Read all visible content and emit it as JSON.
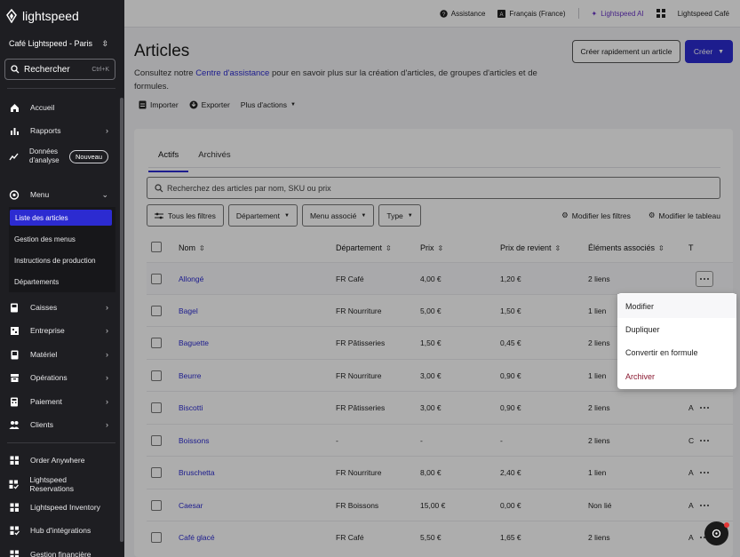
{
  "brand": {
    "name": "lightspeed"
  },
  "sidebar": {
    "store": "Café Lightspeed - Paris",
    "search": {
      "label": "Rechercher",
      "shortcut": "Ctrl+K"
    },
    "items": [
      {
        "label": "Accueil",
        "icon": "home-icon"
      },
      {
        "label": "Rapports",
        "icon": "chart-icon"
      },
      {
        "label": "Données d'analyse",
        "icon": "analytics-icon",
        "badge": "Nouveau"
      },
      {
        "label": "Menu",
        "icon": "menu-icon"
      },
      {
        "label": "Caisses",
        "icon": "register-icon"
      },
      {
        "label": "Entreprise",
        "icon": "business-icon"
      },
      {
        "label": "Matériel",
        "icon": "hardware-icon"
      },
      {
        "label": "Opérations",
        "icon": "operations-icon"
      },
      {
        "label": "Paiement",
        "icon": "payment-icon"
      },
      {
        "label": "Clients",
        "icon": "clients-icon"
      },
      {
        "label": "Order Anywhere",
        "icon": "apps-icon"
      },
      {
        "label": "Lightspeed Reservations",
        "icon": "apps-icon"
      },
      {
        "label": "Lightspeed Inventory",
        "icon": "apps-icon"
      },
      {
        "label": "Hub d'intégrations",
        "icon": "apps-icon"
      },
      {
        "label": "Gestion financière",
        "icon": "apps-icon"
      }
    ],
    "submenu": [
      {
        "label": "Liste des articles",
        "active": true
      },
      {
        "label": "Gestion des menus"
      },
      {
        "label": "Instructions de production"
      },
      {
        "label": "Départements"
      }
    ]
  },
  "topbar": {
    "assistance": "Assistance",
    "language": "Français (France)",
    "ai": "Lightspeed AI",
    "account": "Lightspeed Café"
  },
  "page": {
    "title": "Articles",
    "desc_prefix": "Consultez notre ",
    "desc_link": "Centre d'assistance",
    "desc_suffix": " pour en savoir plus sur la création d'articles, de groupes d'articles et de formules.",
    "quick_create": "Créer rapidement un article",
    "create": "Créer",
    "actions": {
      "import": "Importer",
      "export": "Exporter",
      "more": "Plus d'actions"
    }
  },
  "card": {
    "tabs": [
      "Actifs",
      "Archivés"
    ],
    "search_placeholder": "Recherchez des articles par nom, SKU ou prix",
    "filters": {
      "all": "Tous les filtres",
      "department": "Département",
      "menu": "Menu associé",
      "type": "Type"
    },
    "tools": {
      "edit_filters": "Modifier les filtres",
      "edit_table": "Modifier le tableau"
    },
    "columns": {
      "name": "Nom",
      "department": "Département",
      "price": "Prix",
      "cost": "Prix de revient",
      "linked": "Éléments associés",
      "t": "T"
    },
    "rows": [
      {
        "name": "Allongé",
        "department": "FR Café",
        "price": "4,00 €",
        "cost": "1,20 €",
        "linked": "2 liens",
        "t": ""
      },
      {
        "name": "Bagel",
        "department": "FR Nourriture",
        "price": "5,00 €",
        "cost": "1,50 €",
        "linked": "1 lien",
        "t": ""
      },
      {
        "name": "Baguette",
        "department": "FR Pâtisseries",
        "price": "1,50 €",
        "cost": "0,45 €",
        "linked": "2 liens",
        "t": ""
      },
      {
        "name": "Beurre",
        "department": "FR Nourriture",
        "price": "3,00 €",
        "cost": "0,90 €",
        "linked": "1 lien",
        "t": ""
      },
      {
        "name": "Biscotti",
        "department": "FR Pâtisseries",
        "price": "3,00 €",
        "cost": "0,90 €",
        "linked": "2 liens",
        "t": "A"
      },
      {
        "name": "Boissons",
        "department": "-",
        "price": "-",
        "cost": "-",
        "linked": "2 liens",
        "t": "C"
      },
      {
        "name": "Bruschetta",
        "department": "FR Nourriture",
        "price": "8,00 €",
        "cost": "2,40 €",
        "linked": "1 lien",
        "t": "A"
      },
      {
        "name": "Caesar",
        "department": "FR Boissons",
        "price": "15,00 €",
        "cost": "0,00 €",
        "linked": "Non lié",
        "t": "A"
      },
      {
        "name": "Café glacé",
        "department": "FR Café",
        "price": "5,50 €",
        "cost": "1,65 €",
        "linked": "2 liens",
        "t": "A"
      }
    ]
  },
  "context_menu": [
    "Modifier",
    "Dupliquer",
    "Convertir en formule",
    "Archiver"
  ]
}
